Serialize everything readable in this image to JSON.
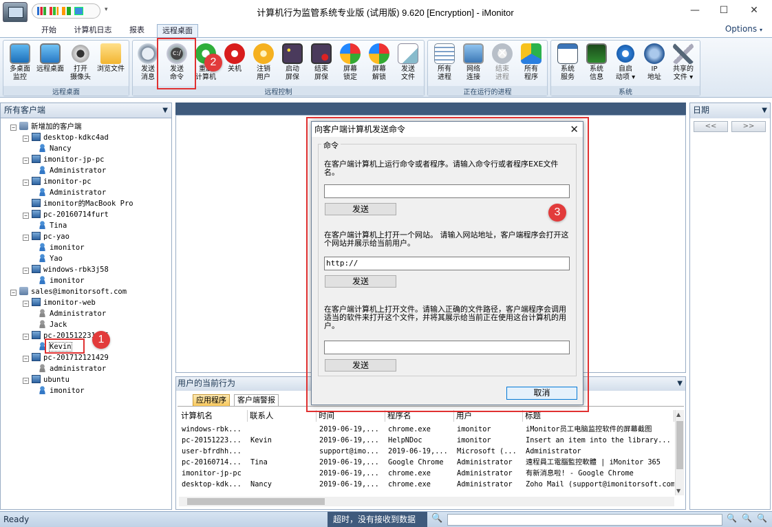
{
  "window": {
    "title": "计算机行为监管系统专业版 (试用版) 9.620 [Encryption] - iMonitor",
    "options_label": "Options",
    "minimize": "—",
    "maximize": "☐",
    "close": "✕"
  },
  "ribbon_tabs": [
    "开始",
    "计算机日志",
    "报表",
    "远程桌面"
  ],
  "ribbon_groups": {
    "remote_desktop": {
      "label": "远程桌面",
      "buttons": [
        "多桌面\n监控",
        "远程桌面",
        "打开\n摄像头",
        "浏览文件"
      ]
    },
    "remote_control": {
      "label": "远程控制",
      "buttons": [
        "发送\n消息",
        "发送\n命令",
        "重启\n计算机",
        "关机",
        "注销\n用户",
        "启动\n屏保",
        "结束\n屏保",
        "屏幕\n锁定",
        "屏幕\n解锁",
        "发送\n文件"
      ]
    },
    "running_process": {
      "label": "正在运行的进程",
      "buttons": [
        "所有\n进程",
        "网络\n连接",
        "结束\n进程",
        "所有\n程序"
      ]
    },
    "system": {
      "label": "系统",
      "buttons": [
        "系统\n服务",
        "系统\n信息",
        "自启\n动项 ▾",
        "IP\n地址",
        "共享的\n文件 ▾"
      ]
    }
  },
  "left_panel": {
    "title": "所有客户端",
    "tree": [
      {
        "label": "新增加的客户端",
        "level": 0,
        "icon": "group-icon",
        "expander": "−"
      },
      {
        "label": "desktop-kdkc4ad",
        "level": 1,
        "icon": "computer-icon",
        "expander": "−"
      },
      {
        "label": "Nancy",
        "level": 2,
        "icon": "user-icon"
      },
      {
        "label": "imonitor-jp-pc",
        "level": 1,
        "icon": "computer-icon",
        "expander": "−"
      },
      {
        "label": "Administrator",
        "level": 2,
        "icon": "user-icon"
      },
      {
        "label": "imonitor-pc",
        "level": 1,
        "icon": "computer-icon",
        "expander": "−"
      },
      {
        "label": "Administrator",
        "level": 2,
        "icon": "user-icon"
      },
      {
        "label": "imonitor的MacBook Pro",
        "level": 1,
        "icon": "computer-icon"
      },
      {
        "label": "pc-20160714furt",
        "level": 1,
        "icon": "computer-icon",
        "expander": "−"
      },
      {
        "label": "Tina",
        "level": 2,
        "icon": "user-icon"
      },
      {
        "label": "pc-yao",
        "level": 1,
        "icon": "computer-icon",
        "expander": "−"
      },
      {
        "label": "imonitor",
        "level": 2,
        "icon": "user-icon"
      },
      {
        "label": "Yao",
        "level": 2,
        "icon": "user-icon"
      },
      {
        "label": "windows-rbk3j58",
        "level": 1,
        "icon": "computer-icon",
        "expander": "−"
      },
      {
        "label": "imonitor",
        "level": 2,
        "icon": "user-icon"
      },
      {
        "label": "sales@imonitorsoft.com",
        "level": 0,
        "icon": "group-icon",
        "expander": "−"
      },
      {
        "label": "imonitor-web",
        "level": 1,
        "icon": "computer-icon",
        "expander": "−"
      },
      {
        "label": "Administrator",
        "level": 2,
        "icon": "user-icon"
      },
      {
        "label": "Jack",
        "level": 2,
        "icon": "user-icon"
      },
      {
        "label": "pc-201512231056",
        "level": 1,
        "icon": "computer-icon",
        "expander": "−"
      },
      {
        "label": "Kevin",
        "level": 2,
        "icon": "user-icon",
        "selected": true
      },
      {
        "label": "pc-201712121429",
        "level": 1,
        "icon": "computer-icon",
        "expander": "−"
      },
      {
        "label": "administrator",
        "level": 2,
        "icon": "user-icon"
      },
      {
        "label": "ubuntu",
        "level": 1,
        "icon": "computer-icon",
        "expander": "−"
      },
      {
        "label": "imonitor",
        "level": 2,
        "icon": "user-icon"
      }
    ]
  },
  "bottom_panel": {
    "title": "用户的当前行为",
    "tabs": [
      "应用程序",
      "客户端警报"
    ],
    "columns": [
      "计算机名",
      "联系人",
      "时间",
      "程序名",
      "用户",
      "标题"
    ],
    "rows": [
      [
        "windows-rbk...",
        "",
        "2019-06-19,...",
        "chrome.exe",
        "imonitor",
        "iMonitor员工电脑监控软件的屏幕截图"
      ],
      [
        "pc-20151223...",
        "Kevin",
        "2019-06-19,...",
        "HelpNDoc",
        "imonitor",
        "Insert an item into the library..."
      ],
      [
        "user-bfrdhh...",
        "",
        "support@imo...",
        "2019-06-19,...",
        "Microsoft (...",
        "Administrator"
      ],
      [
        "pc-20160714...",
        "Tina",
        "2019-06-19,...",
        "Google Chrome",
        "Administrator",
        "遠程員工電腦監控軟體 | iMonitor 365"
      ],
      [
        "imonitor-jp-pc",
        "",
        "2019-06-19,...",
        "chrome.exe",
        "Administrator",
        "有新消息啦! - Google Chrome"
      ],
      [
        "desktop-kdk...",
        "Nancy",
        "2019-06-19,...",
        "chrome.exe",
        "Administrator",
        "Zoho Mail (support@imonitorsoft.com)"
      ]
    ]
  },
  "right_panel": {
    "title": "日期",
    "prev": "<<",
    "next": ">>"
  },
  "dialog": {
    "title": "向客户端计算机发送命令",
    "close": "✕",
    "legend": "命令",
    "section1_text": "在客户端计算机上运行命令或者程序。请输入命令行或者程序EXE文件名。",
    "section1_value": "",
    "section2_text": "在客户端计算机上打开一个网站。 请输入网站地址，客户端程序会打开这个网站并展示给当前用户。",
    "section2_value": "http://",
    "section3_text": "在客户端计算机上打开文件。请输入正确的文件路径，客户端程序会调用适当的软件来打开这个文件，并将其展示给当前正在使用这台计算机的用户。",
    "section3_value": "",
    "send_label": "发送",
    "cancel_label": "取消"
  },
  "status_bar": {
    "ready": "Ready",
    "message": "超时，没有接收到数据"
  },
  "annotations": [
    "1",
    "2",
    "3"
  ],
  "colors": {
    "accent": "#e23b3b",
    "ribbon_active": "#e9f1fa",
    "panel_header": "#3f5a7c"
  }
}
